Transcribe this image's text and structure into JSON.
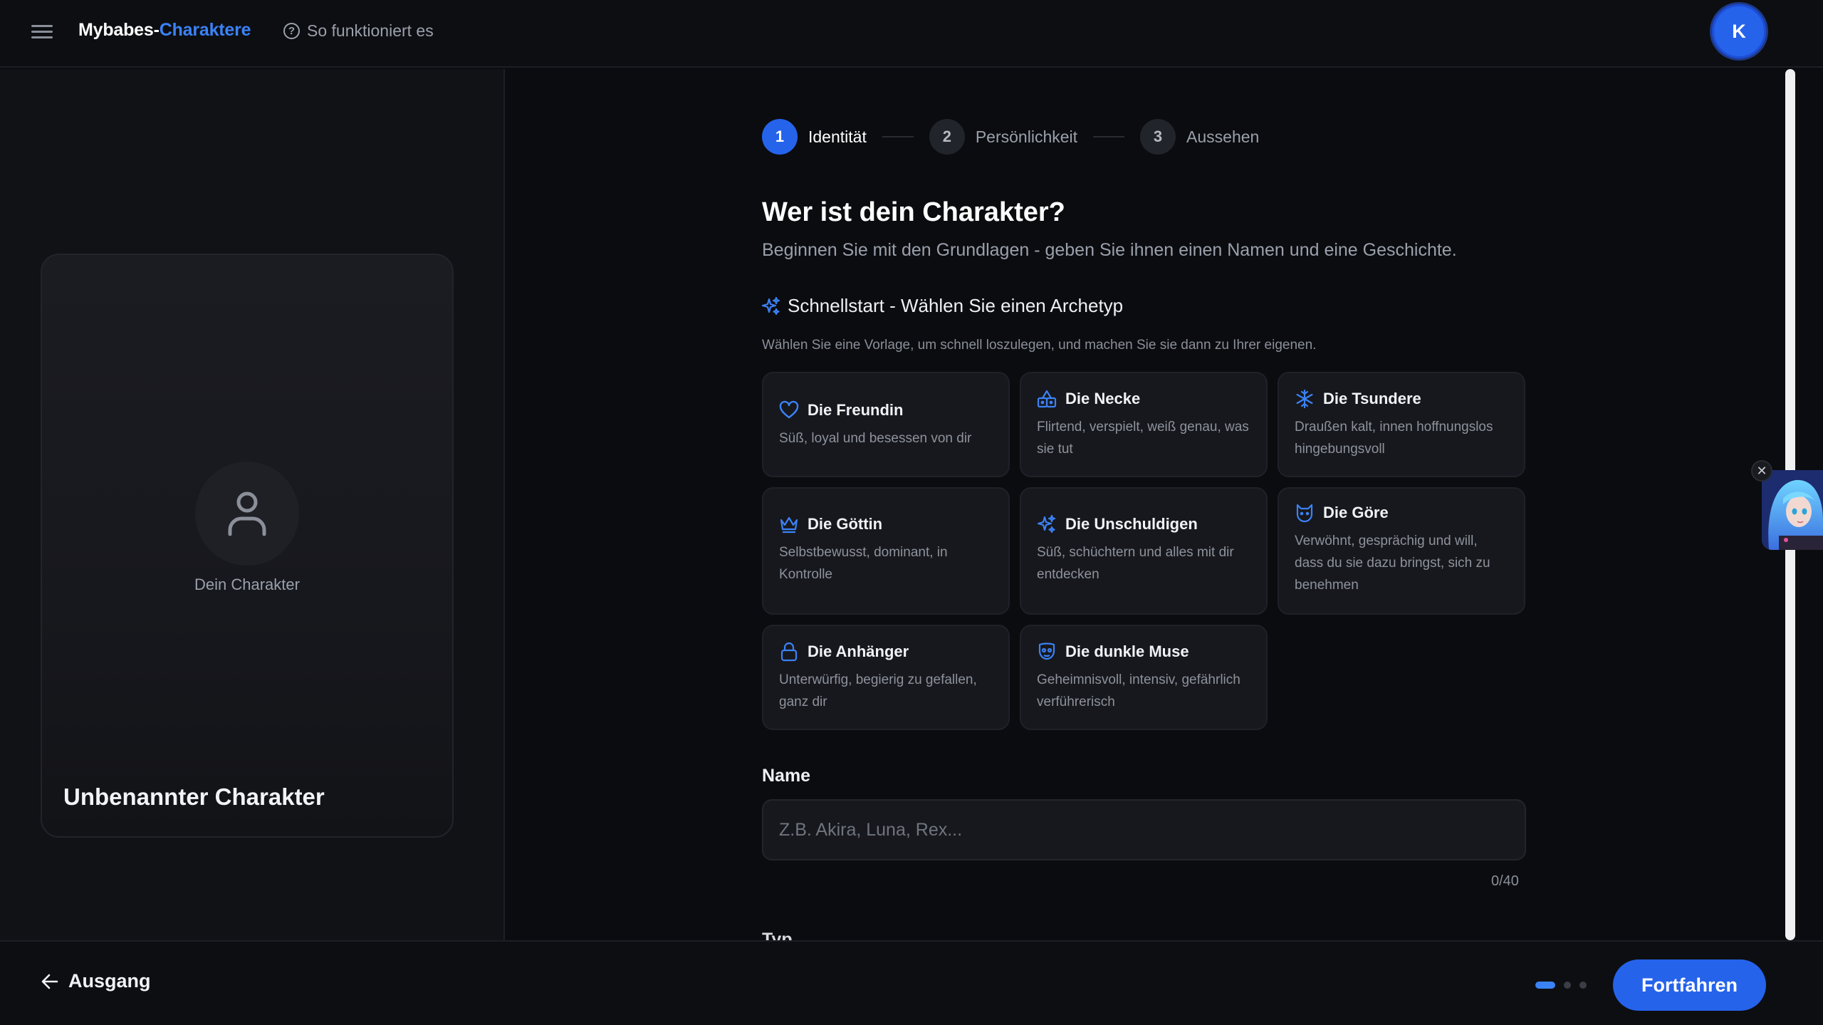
{
  "header": {
    "brand_part1": "Mybabes-",
    "brand_part2": "Charaktere",
    "help_label": "So funktioniert es",
    "avatar_initial": "K"
  },
  "preview": {
    "caption": "Dein Charakter",
    "title": "Unbenannter Charakter"
  },
  "steps": [
    {
      "num": "1",
      "label": "Identität",
      "active": true
    },
    {
      "num": "2",
      "label": "Persönlichkeit",
      "active": false
    },
    {
      "num": "3",
      "label": "Aussehen",
      "active": false
    }
  ],
  "main": {
    "heading": "Wer ist dein Charakter?",
    "subheading": "Beginnen Sie mit den Grundlagen - geben Sie ihnen einen Namen und eine Geschichte.",
    "quickstart_title": "Schnellstart - Wählen Sie einen Archetyp",
    "quickstart_desc": "Wählen Sie eine Vorlage, um schnell loszulegen, und machen Sie sie dann zu Ihrer eigenen."
  },
  "archetypes": [
    {
      "icon": "heart-icon",
      "name": "Die Freundin",
      "desc": "Süß, loyal und besessen von dir"
    },
    {
      "icon": "dice-icon",
      "name": "Die Necke",
      "desc": "Flirtend, verspielt, weiß genau, was sie tut"
    },
    {
      "icon": "snowflake-icon",
      "name": "Die Tsundere",
      "desc": "Draußen kalt, innen hoffnungslos hingebungsvoll"
    },
    {
      "icon": "crown-icon",
      "name": "Die Göttin",
      "desc": "Selbstbewusst, dominant, in Kontrolle"
    },
    {
      "icon": "sparkles-icon",
      "name": "Die Unschuldigen",
      "desc": "Süß, schüchtern und alles mit dir entdecken"
    },
    {
      "icon": "cat-icon",
      "name": "Die Göre",
      "desc": "Verwöhnt, gesprächig und will, dass du sie dazu bringst, sich zu benehmen"
    },
    {
      "icon": "lock-icon",
      "name": "Die Anhänger",
      "desc": "Unterwürfig, begierig zu gefallen, ganz dir"
    },
    {
      "icon": "mask-icon",
      "name": "Die dunkle Muse",
      "desc": "Geheimnisvoll, intensiv, gefährlich verführerisch"
    }
  ],
  "form": {
    "name_label": "Name",
    "name_placeholder": "Z.B. Akira, Luna, Rex...",
    "name_value": "",
    "name_counter": "0/40",
    "type_label": "Typ"
  },
  "footer": {
    "exit_label": "Ausgang",
    "continue_label": "Fortfahren",
    "progress_step": 1,
    "progress_total": 3
  },
  "colors": {
    "accent": "#2563eb",
    "brand_accent": "#3b82f6",
    "background": "#0b0c10"
  }
}
